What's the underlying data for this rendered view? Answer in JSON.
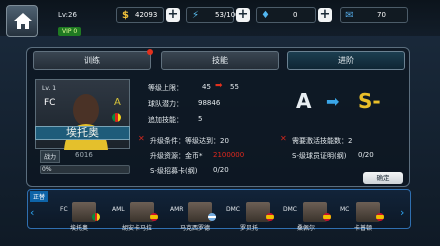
{
  "header": {
    "level": "Lv:26",
    "vip": "VIP 0",
    "resources": [
      {
        "icon": "dollar-icon",
        "value": "42093",
        "color": "#f0c13a"
      },
      {
        "icon": "energy-icon",
        "value": "53/100",
        "color": "#5cc0f2"
      },
      {
        "icon": "diamond-icon",
        "value": "0",
        "color": "#52b6f0"
      },
      {
        "icon": "key-icon",
        "value": "70",
        "color": "#52a5e0"
      }
    ]
  },
  "tabs": [
    {
      "label": "训练",
      "badge": true
    },
    {
      "label": "技能",
      "badge": false
    },
    {
      "label": "进阶",
      "badge": false,
      "active": true
    }
  ],
  "player": {
    "level": "Lv. 1",
    "position": "FC",
    "grade": "A",
    "name": "埃托奥",
    "power_label": "战力",
    "power_value": "6016",
    "progress_label": "0%",
    "progress": 0
  },
  "stats": {
    "level_cap_label": "等级上限：",
    "level_cap_from": "45",
    "level_cap_to": "55",
    "team_potential_label": "球队潜力：",
    "team_potential_value": "98846",
    "extra_skill_label": "追加技能：",
    "extra_skill_value": "5",
    "grade_from": "A",
    "grade_to": "S-"
  },
  "conditions": {
    "cond1": "升级条件：等级达到：20",
    "cond2": "需要激活技能数：2",
    "res_label": "升级资源：金币*",
    "res_value": "2100000",
    "cert_label": "S-级球员证明(纲)",
    "cert_value": "0/20",
    "card_label": "S-级招募卡(纲)",
    "card_value": "0/20",
    "confirm": "确定"
  },
  "bench": {
    "label": "正替",
    "players": [
      {
        "pos": "FC",
        "name": "埃托奥"
      },
      {
        "pos": "AML",
        "name": "胡安卡马拉"
      },
      {
        "pos": "AMR",
        "name": "马克西罗德"
      },
      {
        "pos": "DMC",
        "name": "罗贝托"
      },
      {
        "pos": "DMC",
        "name": "桑佩尔"
      },
      {
        "pos": "MC",
        "name": "卡普顿"
      }
    ]
  }
}
